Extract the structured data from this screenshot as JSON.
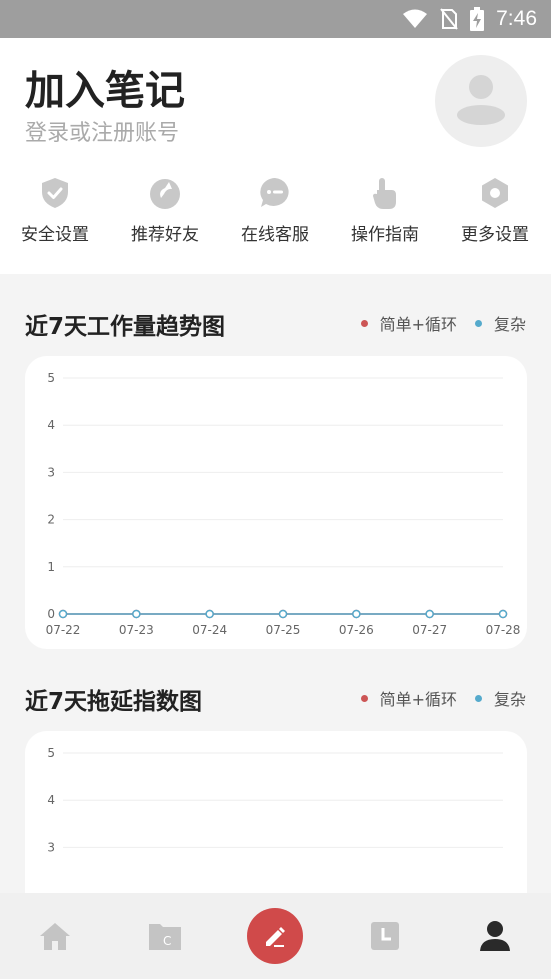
{
  "status_bar": {
    "time": "7:46"
  },
  "header": {
    "title": "加入笔记",
    "subtitle": "登录或注册账号"
  },
  "quick_actions": [
    {
      "label": "安全设置",
      "icon": "shield-check-icon"
    },
    {
      "label": "推荐好友",
      "icon": "share-heart-icon"
    },
    {
      "label": "在线客服",
      "icon": "chat-bubble-icon"
    },
    {
      "label": "操作指南",
      "icon": "hand-pointer-icon"
    },
    {
      "label": "更多设置",
      "icon": "hexagon-gear-icon"
    }
  ],
  "colors": {
    "series_simple": "#cc5555",
    "series_complex": "#55aacc",
    "accent": "#d04a4a",
    "icon_gray": "#c8c8c8"
  },
  "charts": [
    {
      "title": "近7天工作量趋势图",
      "legend": [
        "简单+循环",
        "复杂"
      ]
    },
    {
      "title": "近7天拖延指数图",
      "legend": [
        "简单+循环",
        "复杂"
      ]
    }
  ],
  "chart_data": [
    {
      "type": "line",
      "title": "近7天工作量趋势图",
      "x": [
        "07-22",
        "07-23",
        "07-24",
        "07-25",
        "07-26",
        "07-27",
        "07-28"
      ],
      "y_ticks": [
        0,
        1,
        2,
        3,
        4,
        5
      ],
      "ylim": [
        0,
        5
      ],
      "grid": true,
      "legend_position": "top-right",
      "series": [
        {
          "name": "简单+循环",
          "values": [
            0,
            0,
            0,
            0,
            0,
            0,
            0
          ]
        },
        {
          "name": "复杂",
          "values": [
            0,
            0,
            0,
            0,
            0,
            0,
            0
          ]
        }
      ]
    },
    {
      "type": "line",
      "title": "近7天拖延指数图",
      "y_ticks": [
        5,
        4,
        3
      ],
      "ylim": [
        0,
        5
      ],
      "grid": true,
      "legend_position": "top-right",
      "series": [
        {
          "name": "简单+循环",
          "values": []
        },
        {
          "name": "复杂",
          "values": []
        }
      ]
    }
  ],
  "bottom_nav": [
    {
      "icon": "home-icon"
    },
    {
      "icon": "folder-c-icon",
      "glyph": "C"
    },
    {
      "icon": "pencil-icon"
    },
    {
      "icon": "clock-icon"
    },
    {
      "icon": "user-icon"
    }
  ]
}
